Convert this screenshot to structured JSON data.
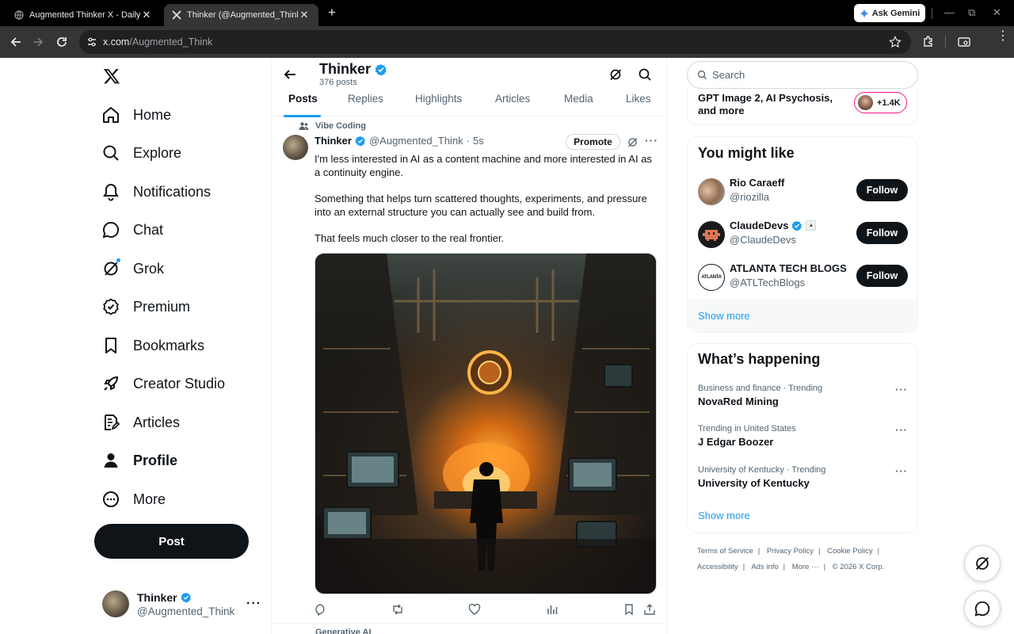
{
  "browser": {
    "tabs": [
      {
        "title": "Augmented Thinker X - Daily Po",
        "active": false
      },
      {
        "title": "Thinker (@Augmented_Think) / X",
        "active": true
      }
    ],
    "ask_gemini": "Ask Gemini",
    "url_host": "x.com",
    "url_path": "/Augmented_Think"
  },
  "nav": {
    "items": [
      {
        "label": "Home",
        "icon": "home-icon"
      },
      {
        "label": "Explore",
        "icon": "search-icon"
      },
      {
        "label": "Notifications",
        "icon": "bell-icon"
      },
      {
        "label": "Chat",
        "icon": "chat-icon"
      },
      {
        "label": "Grok",
        "icon": "grok-icon"
      },
      {
        "label": "Premium",
        "icon": "verified-badge-icon"
      },
      {
        "label": "Bookmarks",
        "icon": "bookmark-icon"
      },
      {
        "label": "Creator Studio",
        "icon": "rocket-icon"
      },
      {
        "label": "Articles",
        "icon": "article-icon"
      },
      {
        "label": "Profile",
        "icon": "person-icon"
      },
      {
        "label": "More",
        "icon": "more-circle-icon"
      }
    ],
    "post_button": "Post",
    "account": {
      "name": "Thinker",
      "handle": "@Augmented_Think"
    }
  },
  "profile_header": {
    "name": "Thinker",
    "posts_count": "376 posts",
    "tabs": [
      "Posts",
      "Replies",
      "Highlights",
      "Articles",
      "Media",
      "Likes"
    ],
    "selected_tab": "Posts"
  },
  "post": {
    "context": "Vibe Coding",
    "author": "Thinker",
    "handle": "@Augmented_Think",
    "separator": "·",
    "time": "5s",
    "promote": "Promote",
    "paragraphs": [
      "I'm less interested in AI as a content machine and more interested in AI as a continuity engine.",
      "Something that helps turn scattered thoughts, experiments, and pressure into an external structure you can actually see and build from.",
      "That feels much closer to the real frontier."
    ],
    "next_context": "Generative AI"
  },
  "right": {
    "search_placeholder": "Search",
    "news": {
      "title": "GPT Image 2, AI Psychosis, and more",
      "count": "+1.4K"
    },
    "suggestions_title": "You might like",
    "suggestions": [
      {
        "name": "Rio Caraeff",
        "handle": "@riozilla",
        "button": "Follow"
      },
      {
        "name": "ClaudeDevs",
        "handle": "@ClaudeDevs",
        "button": "Follow"
      },
      {
        "name": "ATLANTA TECH BLOGS",
        "handle": "@ATLTechBlogs",
        "button": "Follow",
        "logo_text": "ATLANTA"
      }
    ],
    "show_more": "Show more",
    "trends_title": "What’s happening",
    "trends": [
      {
        "context": "Business and finance · Trending",
        "name": "NovaRed Mining"
      },
      {
        "context": "Trending in United States",
        "name": "J Edgar Boozer"
      },
      {
        "context": "University of Kentucky · Trending",
        "name": "University of Kentucky"
      }
    ],
    "footer_row1": [
      "Terms of Service",
      "Privacy Policy",
      "Cookie Policy"
    ],
    "footer_row2": [
      "Accessibility",
      "Ads info",
      "More ···",
      "© 2026 X Corp."
    ]
  },
  "colors": {
    "accent": "#1d9bf0",
    "text": "#0f1419",
    "muted": "#536471",
    "pink": "#f91880"
  }
}
